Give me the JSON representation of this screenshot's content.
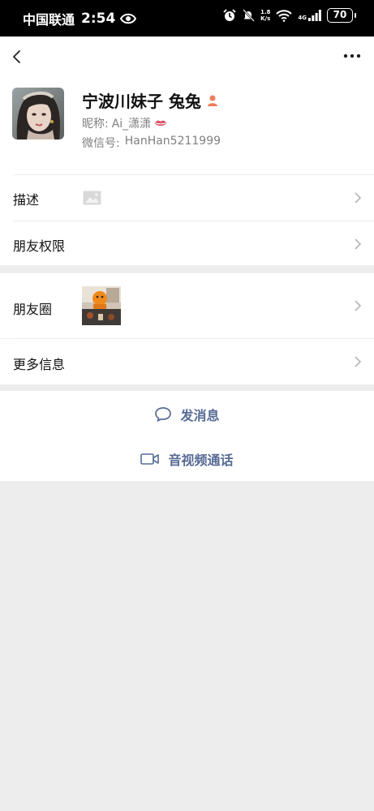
{
  "status_bar": {
    "carrier": "中国联通",
    "time": "2:54",
    "net_speed_value": "1.8",
    "net_speed_unit": "K/s",
    "network": "4G",
    "battery": "70",
    "icons": [
      "eye-icon",
      "alarm-icon",
      "mute-icon",
      "wifi-icon",
      "signal-icon",
      "battery-icon"
    ]
  },
  "header": {
    "back_icon": "chevron-left-icon",
    "more_icon": "more-dots-icon"
  },
  "profile": {
    "name": "宁波川妹子 兔兔",
    "nickname_label": "昵称:",
    "nickname_value": "Ai_潇潇",
    "wechat_id_label": "微信号:",
    "wechat_id_value": "HanHan5211999",
    "badge_icon": "female-person-icon",
    "nickname_emoji": "lips-icon"
  },
  "rows": {
    "description": "描述",
    "permissions": "朋友权限",
    "moments": "朋友圈",
    "more_info": "更多信息"
  },
  "actions": {
    "message": "发消息",
    "video_call": "音视频通话"
  },
  "colors": {
    "link_blue": "#576b95",
    "badge_orange": "#f07c5a",
    "background": "#ededed"
  }
}
